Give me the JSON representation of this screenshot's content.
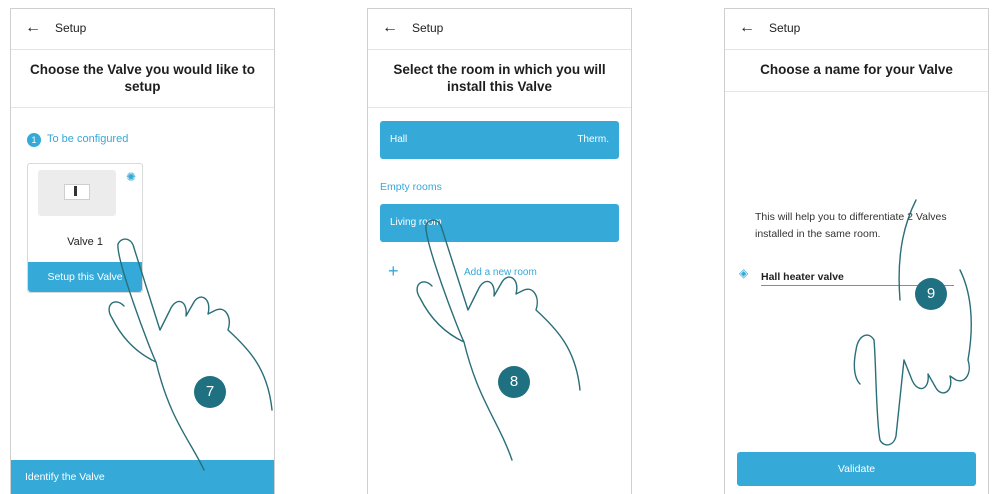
{
  "colors": {
    "accent": "#35a9d8",
    "step_badge": "#1f7080"
  },
  "screen1": {
    "top_title": "Setup",
    "heading": "Choose the Valve you would like to setup",
    "badge_count": "1",
    "section_label": "To be configured",
    "device_name": "Valve 1",
    "setup_button": "Setup this Valve",
    "bottom_button": "Identify the Valve",
    "step": "7"
  },
  "screen2": {
    "top_title": "Setup",
    "heading": "Select the room in which you will install this Valve",
    "room_hall": "Hall",
    "room_hall_tag": "Therm.",
    "empty_rooms_label": "Empty rooms",
    "room_living": "Living room",
    "add_room": "Add a new room",
    "step": "8"
  },
  "screen3": {
    "top_title": "Setup",
    "heading": "Choose a name for your Valve",
    "helper_text": "This will help you to differentiate 2 Valves installed in the same room.",
    "name_value": "Hall heater valve",
    "validate_button": "Validate",
    "step": "9"
  }
}
